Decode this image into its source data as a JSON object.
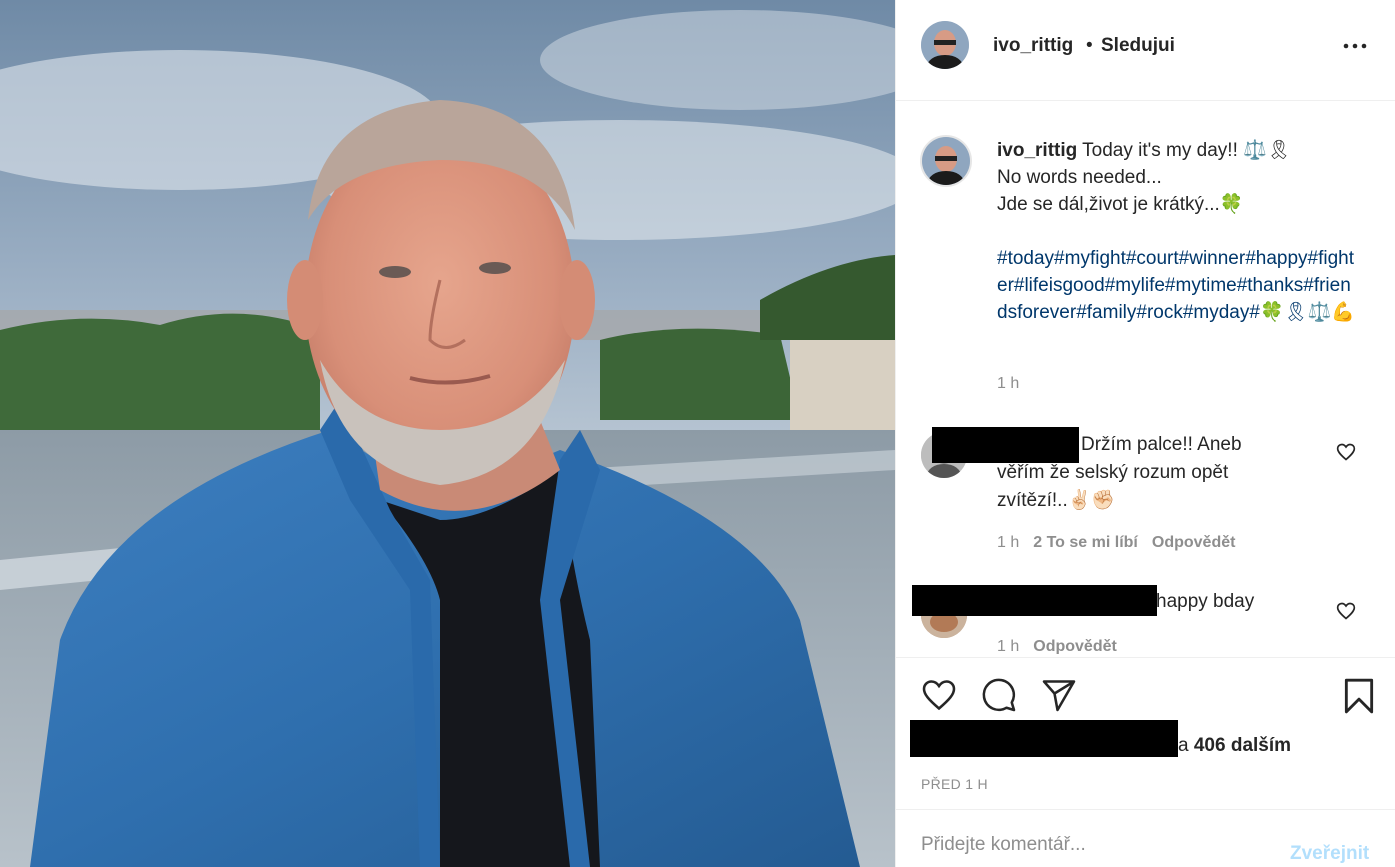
{
  "post": {
    "username": "ivo_rittig",
    "separator": "•",
    "follow_status": "Sledujui"
  },
  "caption": {
    "username": "ivo_rittig",
    "text": " Today it's my day!! ⚖️🎗\nNo words needed...\nJde se dál,život je krátký...🍀",
    "hashtags": "#today#myfight#court#winner#happy#fighter#lifeisgood#mylife#mytime#thanks#friendsforever#family#rock#myday#🍀🎗⚖️💪",
    "time": "1 h"
  },
  "comments": [
    {
      "text": "Držím palce!! Aneb\nvěřím že selský rozum opět\nzvítězí!..✌🏻✊🏻",
      "time": "1 h",
      "likes": "2 To se mi líbí",
      "reply": "Odpovědět"
    },
    {
      "text": "happy bday",
      "time": "1 h",
      "reply": "Odpovědět"
    }
  ],
  "likes": {
    "connector": "a",
    "count_text": "406 dalším"
  },
  "posted_ago": "PŘED 1 H",
  "add_comment": {
    "placeholder": "Přidejte komentář...",
    "publish_label": "Zveřejnit"
  },
  "icons": {
    "more": "more-horizontal-icon",
    "like": "heart-icon",
    "comment": "comment-icon",
    "share": "paper-plane-icon",
    "save": "bookmark-icon"
  },
  "colors": {
    "hashtag": "#00376b",
    "muted": "#8e8e8e",
    "publish_disabled": "#b2dffc",
    "text": "#262626"
  }
}
